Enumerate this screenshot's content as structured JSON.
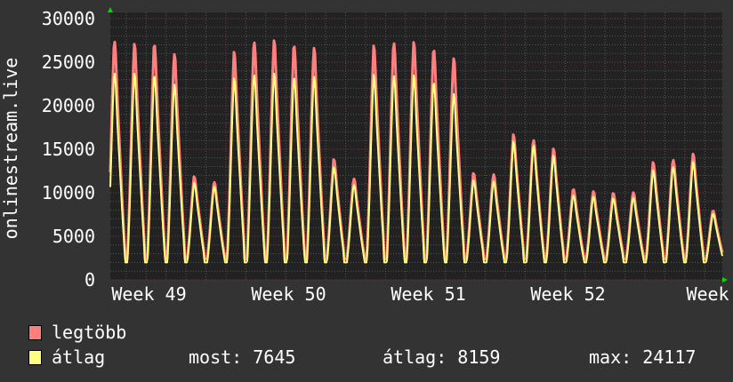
{
  "chart_data": {
    "type": "line",
    "ylabel": "onlinestream.live",
    "ylim": [
      0,
      30000
    ],
    "yticks": [
      "0",
      "5000",
      "10000",
      "15000",
      "20000",
      "25000",
      "30000"
    ],
    "xtick_labels": [
      "Week 49",
      "Week 50",
      "Week 51",
      "Week 52",
      "Week"
    ],
    "grid": true,
    "colors": {
      "background": "#333333",
      "plot": "#222222",
      "grid_minor": "#555555",
      "grid_major": "#7a3a3a",
      "legtobb": "#ff7f7f",
      "atlag": "#ffff80",
      "arrow": "#00dd00"
    },
    "x_note_days": "one peak per day, about 31 days shown",
    "series": [
      {
        "name": "legtöbb",
        "daily_peak": [
          27700,
          27200,
          27300,
          26100,
          11900,
          11300,
          26200,
          27600,
          27600,
          27200,
          26800,
          13900,
          11700,
          26900,
          27500,
          27400,
          26700,
          25600,
          12300,
          12200,
          16700,
          16200,
          15100,
          10500,
          10200,
          10000,
          10100,
          13500,
          13900,
          14500,
          8000
        ],
        "daily_trough": 2400
      },
      {
        "name": "átlag",
        "daily_peak": [
          24000,
          23800,
          23700,
          22600,
          11200,
          10800,
          23200,
          23800,
          23800,
          23500,
          23500,
          13000,
          11000,
          23600,
          23700,
          23600,
          22900,
          21500,
          11500,
          11400,
          15900,
          15600,
          14300,
          9800,
          9600,
          9400,
          9500,
          12600,
          13100,
          13600,
          7645
        ],
        "daily_trough": 2000
      }
    ]
  },
  "legend": {
    "items": [
      {
        "label": "legtöbb",
        "color": "#ff7f7f"
      },
      {
        "label": "átlag",
        "color": "#ffff80"
      }
    ],
    "stats": {
      "most": "most: 7645",
      "atlag": "átlag: 8159",
      "max": "max: 24117"
    }
  }
}
